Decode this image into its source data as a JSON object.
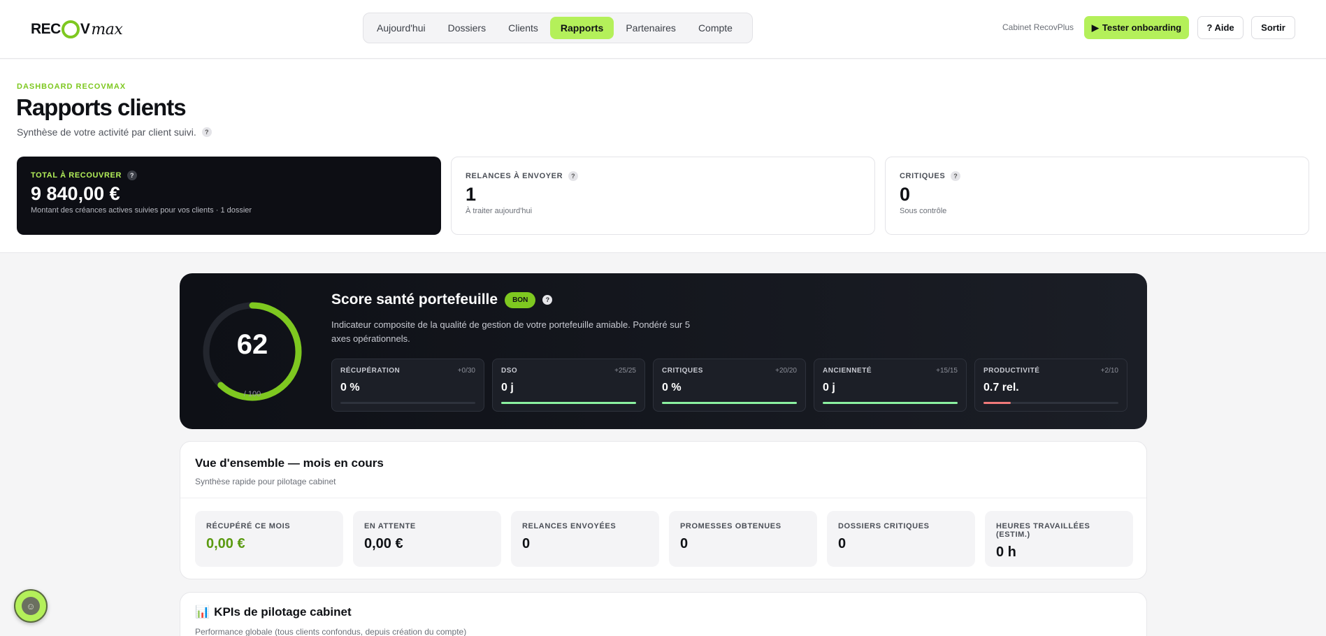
{
  "brand": {
    "logo_text_a": "REC",
    "logo_text_b": "V",
    "logo_script": "max"
  },
  "nav": {
    "tabs": [
      "Aujourd'hui",
      "Dossiers",
      "Clients",
      "Rapports",
      "Partenaires",
      "Compte"
    ],
    "active": "Rapports"
  },
  "header": {
    "cabinet": "Cabinet RecovPlus",
    "onboarding": "Tester onboarding",
    "onboarding_icon": "▶",
    "help": "? Aide",
    "logout": "Sortir"
  },
  "page": {
    "eyebrow": "DASHBOARD RECOVMAX",
    "title": "Rapports clients",
    "subtitle": "Synthèse de votre activité par client suivi."
  },
  "stats": {
    "total": {
      "label": "TOTAL À RECOUVRER",
      "value": "9 840,00 €",
      "desc": "Montant des créances actives suivies pour vos clients · 1 dossier"
    },
    "relances": {
      "label": "RELANCES À ENVOYER",
      "value": "1",
      "desc": "À traiter aujourd'hui"
    },
    "critiques": {
      "label": "CRITIQUES",
      "value": "0",
      "desc": "Sous contrôle"
    }
  },
  "score": {
    "value": "62",
    "max": "/ 100",
    "progress": 0.62,
    "title": "Score santé portefeuille",
    "badge": "BON",
    "desc": "Indicateur composite de la qualité de gestion de votre portefeuille amiable. Pondéré sur 5 axes opérationnels.",
    "ring_color": "#7ec820",
    "axes": [
      {
        "name": "RÉCUPÉRATION",
        "points": "+0/30",
        "value": "0 %",
        "fill": 0,
        "color": "#8bf0a0"
      },
      {
        "name": "DSO",
        "points": "+25/25",
        "value": "0 j",
        "fill": 1,
        "color": "#8bf0a0"
      },
      {
        "name": "CRITIQUES",
        "points": "+20/20",
        "value": "0 %",
        "fill": 1,
        "color": "#8bf0a0"
      },
      {
        "name": "ANCIENNETÉ",
        "points": "+15/15",
        "value": "0 j",
        "fill": 1,
        "color": "#8bf0a0"
      },
      {
        "name": "PRODUCTIVITÉ",
        "points": "+2/10",
        "value": "0.7 rel.",
        "fill": 0.2,
        "color": "#f07a7a"
      }
    ]
  },
  "overview": {
    "title": "Vue d'ensemble — mois en cours",
    "subtitle": "Synthèse rapide pour pilotage cabinet",
    "cards": [
      {
        "label": "RÉCUPÉRÉ CE MOIS",
        "value": "0,00 €"
      },
      {
        "label": "EN ATTENTE",
        "value": "0,00 €"
      },
      {
        "label": "RELANCES ENVOYÉES",
        "value": "0"
      },
      {
        "label": "PROMESSES OBTENUES",
        "value": "0"
      },
      {
        "label": "DOSSIERS CRITIQUES",
        "value": "0"
      },
      {
        "label": "HEURES TRAVAILLÉES (ESTIM.)",
        "value": "0 h"
      }
    ]
  },
  "kpi": {
    "icon": "📊",
    "title": "KPIs de pilotage cabinet",
    "subtitle": "Performance globale (tous clients confondus, depuis création du compte)"
  }
}
